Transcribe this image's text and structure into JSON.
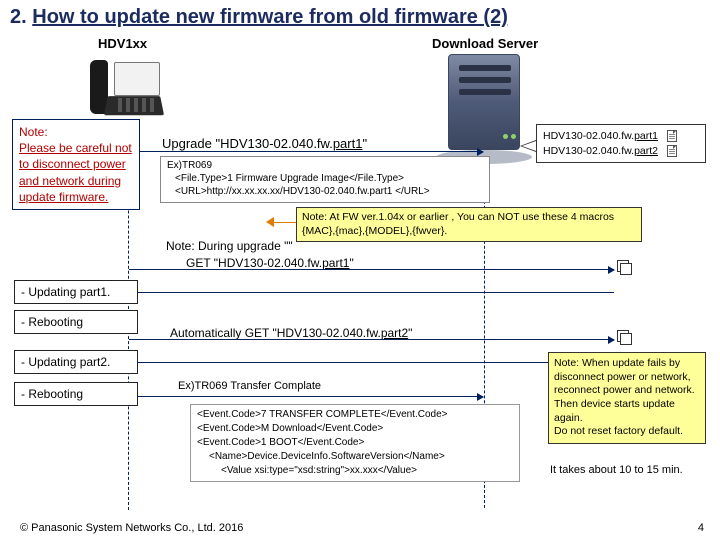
{
  "title_prefix": "2. ",
  "title_main": "How to update new firmware from old firmware (2)",
  "hdv_label": "HDV1xx",
  "download_server_label": "Download Server",
  "care_note_label": "Note:",
  "care_note_body": "Please be careful not to disconnect power and network during update firmware.",
  "upgrade_prefix": "Upgrade \"HDV130-02.040.fw.",
  "upgrade_part": "part1",
  "upgrade_suffix": "\"",
  "tr069_ex_label": "Ex)TR069",
  "tr069_line1": "<File.Type>1 Firmware Upgrade Image</File.Type>",
  "tr069_line2": "<URL>http://xx.xx.xx.xx/HDV130-02.040.fw.part1 </URL>",
  "macro_note": "Note: At FW ver.1.04x or earlier , You can NOT use these 4 macros {MAC},{mac},{MODEL},{fwver}.",
  "note_during": "Note: During upgrade \"\"",
  "get_prefix": "GET \"HDV130-02.040.fw.",
  "get_part": "part1",
  "get_suffix": "\"",
  "side": {
    "updating1": "- Updating part1.",
    "reboot1": "- Rebooting",
    "updating2": "- Updating  part2.",
    "reboot2": "- Rebooting"
  },
  "auto_get_prefix": "Automatically GET \"HDV130-02.040.fw.",
  "auto_get_part": "part2",
  "auto_get_suffix": "\"",
  "tr069_complete": "Ex)TR069 Transfer Complate",
  "eventcodes": {
    "l1": "<Event.Code>7 TRANSFER COMPLETE</Event.Code>",
    "l2": "<Event.Code>M Download</Event.Code>",
    "l3": "<Event.Code>1 BOOT</Event.Code>",
    "l4": "<Name>Device.DeviceInfo.SoftwareVersion</Name>",
    "l5": "<Value xsi:type=\"xsd:string\">xx.xxx</Value>"
  },
  "file_bubble": {
    "f1_pre": "HDV130-02.040.fw.",
    "f1_part": "part1",
    "f2_pre": "HDV130-02.040.fw.",
    "f2_part": "part2"
  },
  "fail_note": "Note: When update fails by disconnect power or network, reconnect power and network. Then device starts update again.\nDo not reset factory default.",
  "time_note": "It takes about 10 to 15 min.",
  "footer": "© Panasonic System Networks Co., Ltd.  2016",
  "page": "4"
}
